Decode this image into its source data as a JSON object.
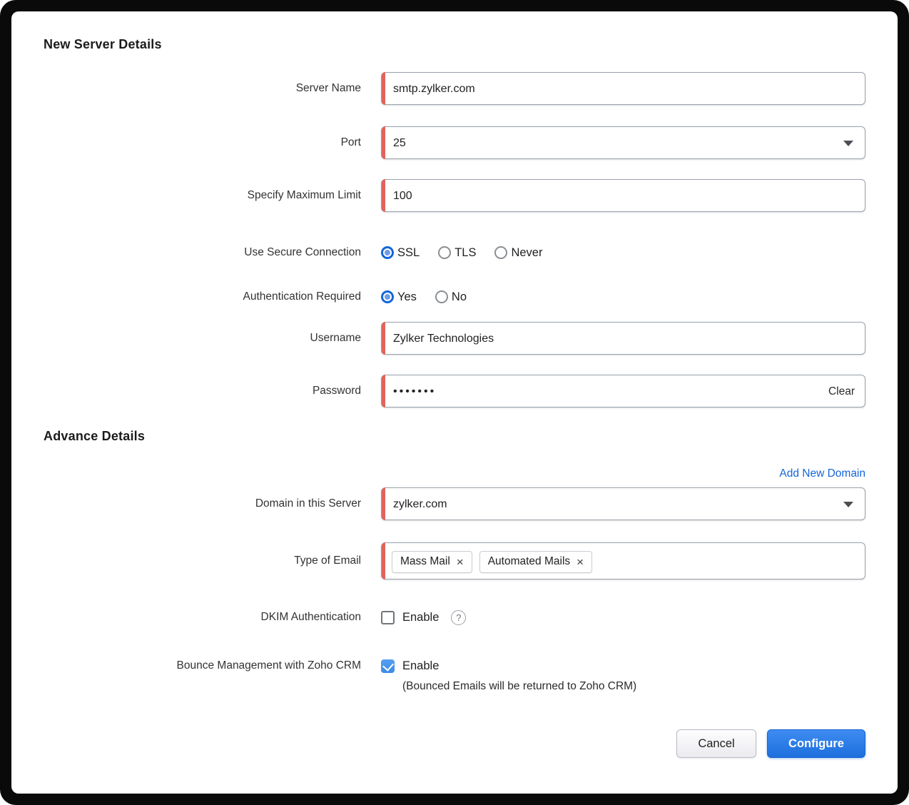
{
  "sections": {
    "server_details_title": "New Server Details",
    "advance_details_title": "Advance Details"
  },
  "fields": {
    "server_name": {
      "label": "Server Name",
      "value": "smtp.zylker.com"
    },
    "port": {
      "label": "Port",
      "value": "25"
    },
    "max_limit": {
      "label": "Specify Maximum Limit",
      "value": "100"
    },
    "secure_connection": {
      "label": "Use Secure Connection",
      "options": [
        {
          "label": "SSL",
          "selected": true
        },
        {
          "label": "TLS",
          "selected": false
        },
        {
          "label": "Never",
          "selected": false
        }
      ]
    },
    "auth_required": {
      "label": "Authentication Required",
      "options": [
        {
          "label": "Yes",
          "selected": true
        },
        {
          "label": "No",
          "selected": false
        }
      ]
    },
    "username": {
      "label": "Username",
      "value": "Zylker Technologies"
    },
    "password": {
      "label": "Password",
      "value": "•••••••",
      "clear_label": "Clear"
    },
    "domain": {
      "label": "Domain in this Server",
      "value": "zylker.com"
    },
    "email_type": {
      "label": "Type of Email",
      "chips": [
        {
          "label": "Mass Mail",
          "remove": "×"
        },
        {
          "label": "Automated Mails",
          "remove": "×"
        }
      ]
    },
    "dkim": {
      "label": "DKIM Authentication",
      "checkbox_label": "Enable",
      "checked": false,
      "help": "?"
    },
    "bounce": {
      "label": "Bounce Management with Zoho CRM",
      "checkbox_label": "Enable",
      "checked": true,
      "note": "(Bounced Emails will be returned to Zoho CRM)"
    }
  },
  "links": {
    "add_new_domain": "Add New Domain"
  },
  "buttons": {
    "cancel": "Cancel",
    "configure": "Configure"
  },
  "colors": {
    "required_accent": "#e2635b",
    "link_blue": "#1565d8",
    "radio_selected_blue": "#1466d8",
    "checkbox_blue": "#3d8ae8",
    "primary_button_blue": "#1d6fdd"
  }
}
